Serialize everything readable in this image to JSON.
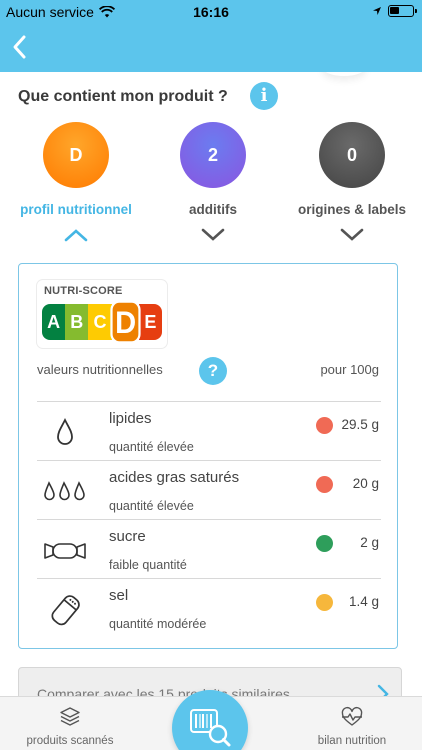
{
  "status": {
    "carrier": "Aucun service",
    "time": "16:16"
  },
  "header": {
    "section_title": "Que contient mon produit ?",
    "info_symbol": "i"
  },
  "categories": [
    {
      "value": "D",
      "label": "profil nutritionnel",
      "color": "#ff8a00",
      "active": true
    },
    {
      "value": "2",
      "label": "additifs",
      "color": "#7a5ee8",
      "active": false
    },
    {
      "value": "0",
      "label": "origines & labels",
      "color": "#555555",
      "active": false
    }
  ],
  "nutriscore": {
    "title": "NUTRI-SCORE",
    "letters": [
      "A",
      "B",
      "C",
      "D",
      "E"
    ],
    "grade": "D"
  },
  "nutrition": {
    "values_label": "valeurs nutritionnelles",
    "help_symbol": "?",
    "per_label": "pour 100g",
    "rows": [
      {
        "icon": "drop-icon",
        "name": "lipides",
        "level": "quantité élevée",
        "value": "29.5 g",
        "color": "#f06a55"
      },
      {
        "icon": "three-drops-icon",
        "name": "acides gras saturés",
        "level": "quantité élevée",
        "value": "20 g",
        "color": "#f06a55"
      },
      {
        "icon": "candy-icon",
        "name": "sucre",
        "level": "faible quantité",
        "value": "2 g",
        "color": "#2e9e5b"
      },
      {
        "icon": "salt-shaker-icon",
        "name": "sel",
        "level": "quantité modérée",
        "value": "1.4 g",
        "color": "#f6b73c"
      }
    ]
  },
  "compare": {
    "label": "Comparer avec les 15 produits similaires"
  },
  "tabbar": {
    "left_label": "produits scannés",
    "right_label": "bilan nutrition"
  },
  "colors": {
    "accent": "#5cc5ec",
    "active_label": "#44b6e4"
  }
}
